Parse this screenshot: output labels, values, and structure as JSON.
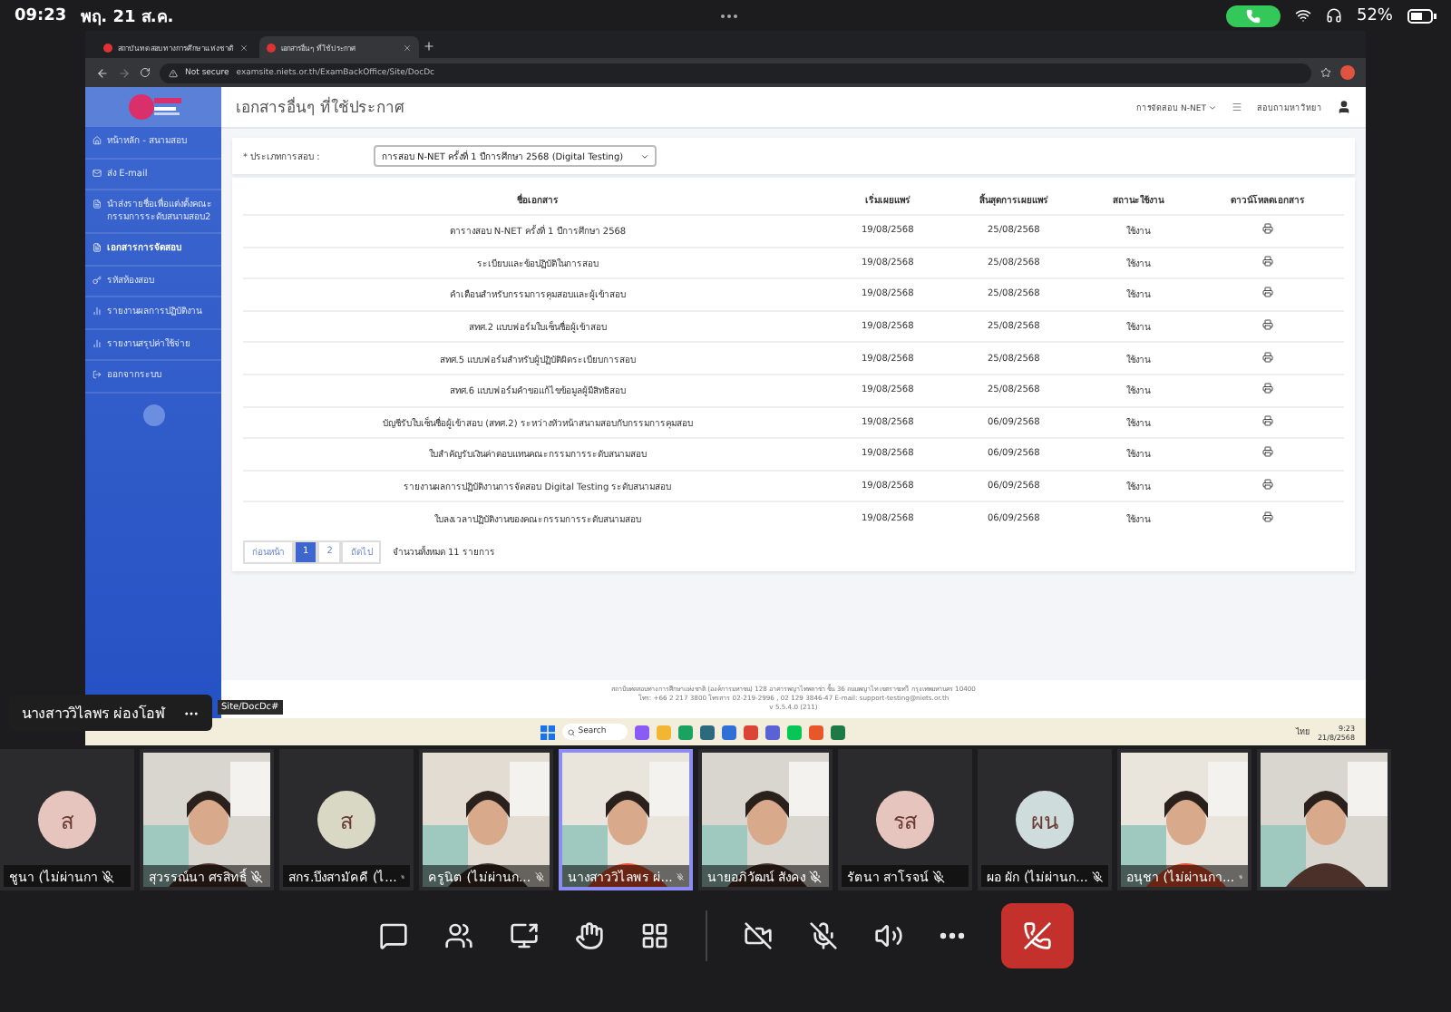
{
  "status_bar": {
    "time": "09:23",
    "date": "พฤ. 21 ส.ค.",
    "battery": "52%"
  },
  "browser": {
    "tabs": [
      {
        "title": "สถาบันทดสอบทางการศึกษาแห่งชาติ",
        "selected": false
      },
      {
        "title": "เอกสารอื่นๆ ที่ใช้ประกาศ",
        "selected": true
      }
    ],
    "security": "Not secure",
    "url": "examsite.niets.or.th/ExamBackOffice/Site/DocDc"
  },
  "page": {
    "sidebar": {
      "items": [
        {
          "label": "หน้าหลัก - สนามสอบ",
          "selected": false
        },
        {
          "label": "ส่ง E-mail",
          "selected": false
        },
        {
          "label": "นำส่งรายชื่อเพื่อแต่งตั้งคณะกรรมการระดับสนามสอบ2",
          "selected": false
        },
        {
          "label": "เอกสารการจัดสอบ",
          "selected": true
        },
        {
          "label": "รหัสห้องสอบ",
          "selected": false
        },
        {
          "label": "รายงานผลการปฏิบัติงาน",
          "selected": false
        },
        {
          "label": "รายงานสรุปค่าใช้จ่าย",
          "selected": false
        },
        {
          "label": "ออกจากระบบ",
          "selected": false
        }
      ]
    },
    "title": "เอกสารอื่นๆ ที่ใช้ประกาศ",
    "menu": "การจัดสอบ N-NET",
    "user": "สอบถามหาวิทยา",
    "filter": {
      "label": "* ประเภทการสอบ :",
      "value": "การสอบ N-NET ครั้งที่ 1 ปีการศึกษา 2568 (Digital Testing)"
    },
    "table": {
      "columns": [
        "ชื่อเอกสาร",
        "เริ่มเผยแพร่",
        "สิ้นสุดการเผยแพร่",
        "สถานะใช้งาน",
        "ดาวน์โหลดเอกสาร"
      ],
      "rows": [
        [
          "ตารางสอบ N-NET ครั้งที่ 1 ปีการศึกษา 2568",
          "19/08/2568",
          "25/08/2568",
          "ใช้งาน"
        ],
        [
          "ระเบียบและข้อปฏิบัติในการสอบ",
          "19/08/2568",
          "25/08/2568",
          "ใช้งาน"
        ],
        [
          "คำเตือนสำหรับกรรมการคุมสอบและผู้เข้าสอบ",
          "19/08/2568",
          "25/08/2568",
          "ใช้งาน"
        ],
        [
          "สทศ.2 แบบฟอร์มใบเซ็นชื่อผู้เข้าสอบ",
          "19/08/2568",
          "25/08/2568",
          "ใช้งาน"
        ],
        [
          "สทศ.5 แบบฟอร์มสำหรับผู้ปฏิบัติผิดระเบียบการสอบ",
          "19/08/2568",
          "25/08/2568",
          "ใช้งาน"
        ],
        [
          "สทศ.6 แบบฟอร์มคำขอแก้ไขข้อมูลผู้มีสิทธิสอบ",
          "19/08/2568",
          "25/08/2568",
          "ใช้งาน"
        ],
        [
          "บัญชีรับใบเซ็นชื่อผู้เข้าสอบ (สทศ.2) ระหว่างหัวหน้าสนามสอบกับกรรมการคุมสอบ",
          "19/08/2568",
          "06/09/2568",
          "ใช้งาน"
        ],
        [
          "ใบสำคัญรับเงินค่าตอบแทนคณะกรรมการระดับสนามสอบ",
          "19/08/2568",
          "06/09/2568",
          "ใช้งาน"
        ],
        [
          "รายงานผลการปฏิบัติงานการจัดสอบ Digital Testing ระดับสนามสอบ",
          "19/08/2568",
          "06/09/2568",
          "ใช้งาน"
        ],
        [
          "ใบลงเวลาปฏิบัติงานของคณะกรรมการระดับสนามสอบ",
          "19/08/2568",
          "06/09/2568",
          "ใช้งาน"
        ]
      ]
    },
    "pagination": {
      "prev": "ก่อนหน้า",
      "pages": [
        {
          "label": "1",
          "selected": true
        },
        {
          "label": "2",
          "selected": false
        }
      ],
      "next": "ถัดไป",
      "total": "จำนวนทั้งหมด 11 รายการ"
    },
    "footer": [
      "สถาบันทดสอบทางการศึกษาแห่งชาติ (องค์การมหาชน) 128 อาคารพญาไทพลาซ่า ชั้น 36 ถนนพญาไท เขตราชเทวี กรุงเทพมหานคร 10400",
      "โทร: +66 2 217 3800 โทรสาร 02-219-2996 , 02 129 3846-47 E-mail: support-testing@niets.or.th",
      "v 5.5.4.0 (211)"
    ]
  },
  "taskbar": {
    "search": "Search",
    "language": "ไทย",
    "time": "9:23",
    "date": "21/8/2568"
  },
  "link_tooltip": "Site/DocDc#",
  "presenter": "นางสาววิไลพร ผ่องโอฬ",
  "participants": [
    {
      "name": "ชูนา (ไม่ผ่านกา",
      "kind": "avatar",
      "initials": "ส",
      "color": "#e6c5be",
      "active": false
    },
    {
      "name": "สุวรรณ์นา ศรสิทธิ์",
      "kind": "video",
      "active": false
    },
    {
      "name": "สกร.บึงสามัคคี (ไ...",
      "kind": "avatar",
      "initials": "ส",
      "color": "#d8d8c4",
      "active": false
    },
    {
      "name": "ครูนิต (ไม่ผ่านก...",
      "kind": "video",
      "active": false
    },
    {
      "name": "นางสาววิไลพร ผ่...",
      "kind": "video",
      "active": true
    },
    {
      "name": "นายอภิวัฒน์ สังคง",
      "kind": "video",
      "active": false
    },
    {
      "name": "รัตนา สาโรจน์",
      "kind": "avatar",
      "initials": "รส",
      "color": "#e6c5be",
      "active": false
    },
    {
      "name": "ผอ ผัก (ไม่ผ่านก...",
      "kind": "avatar",
      "initials": "ผน",
      "color": "#cfdcdc",
      "active": false
    },
    {
      "name": "อนุชา (ไม่ผ่านกา...",
      "kind": "video",
      "active": false
    },
    {
      "kind": "video",
      "active": false
    }
  ]
}
